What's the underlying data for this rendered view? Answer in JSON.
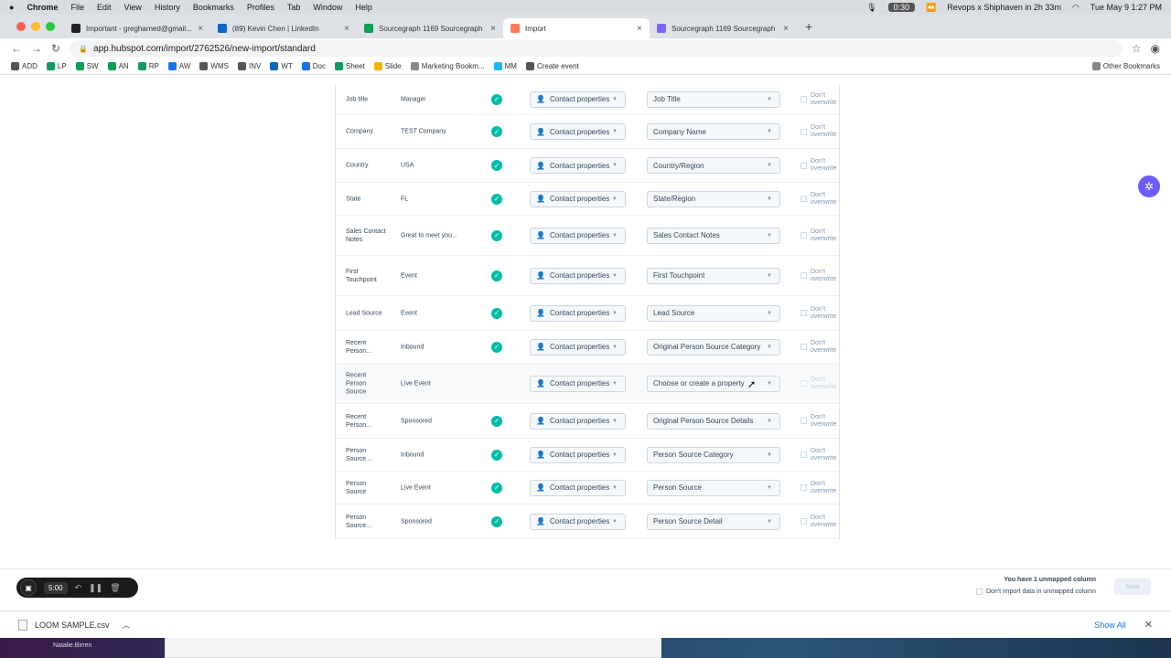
{
  "menubar": {
    "app": "Chrome",
    "items": [
      "File",
      "Edit",
      "View",
      "History",
      "Bookmarks",
      "Profiles",
      "Tab",
      "Window",
      "Help"
    ],
    "recording_time": "0:30",
    "calendar": "Revops x Shiphaven in 2h 33m",
    "clock": "Tue May 9  1:27 PM"
  },
  "tabs": [
    {
      "title": "Important - gregharned@gmail...",
      "color": "#222222",
      "badge": "14"
    },
    {
      "title": "(89) Kevin Chen | LinkedIn",
      "color": "#0a66c2"
    },
    {
      "title": "Sourcegraph 1169 Sourcegraph",
      "color": "#0f9d58"
    },
    {
      "title": "Import",
      "color": "#ff7a59",
      "active": true
    },
    {
      "title": "Sourcegraph 1169 Sourcegraph",
      "color": "#7b61ff"
    }
  ],
  "address": {
    "url": "app.hubspot.com/import/2762526/new-import/standard"
  },
  "bookmarks": [
    {
      "label": "ADD",
      "color": "#555"
    },
    {
      "label": "LP",
      "color": "#0f9d58"
    },
    {
      "label": "SW",
      "color": "#0f9d58"
    },
    {
      "label": "AN",
      "color": "#0f9d58"
    },
    {
      "label": "RP",
      "color": "#0f9d58"
    },
    {
      "label": "AW",
      "color": "#1a73e8"
    },
    {
      "label": "WMS",
      "color": "#555"
    },
    {
      "label": "INV",
      "color": "#555"
    },
    {
      "label": "WT",
      "color": "#0a66c2"
    },
    {
      "label": "Doc",
      "color": "#1a73e8"
    },
    {
      "label": "Sheet",
      "color": "#0f9d58"
    },
    {
      "label": "Slide",
      "color": "#f4b400"
    },
    {
      "label": "Marketing Bookm...",
      "color": "#888"
    },
    {
      "label": "MM",
      "color": "#1ab7ea"
    },
    {
      "label": "Create event",
      "color": "#555"
    }
  ],
  "other_bookmarks": "Other Bookmarks",
  "mapping": {
    "rows": [
      {
        "column": "Job title",
        "preview": "Manager",
        "mapped": true,
        "object": "Contact properties",
        "property": "Job Title",
        "overwrite": "Don't overwrite"
      },
      {
        "column": "Company",
        "preview": "TEST Company",
        "mapped": true,
        "object": "Contact properties",
        "property": "Company Name",
        "overwrite": "Don't overwrite"
      },
      {
        "column": "Country",
        "preview": "USA",
        "mapped": true,
        "object": "Contact properties",
        "property": "Country/Region",
        "overwrite": "Don't overwrite"
      },
      {
        "column": "State",
        "preview": "FL",
        "mapped": true,
        "object": "Contact properties",
        "property": "State/Region",
        "overwrite": "Don't overwrite"
      },
      {
        "column": "Sales Contact Notes",
        "preview": "Great to meet you...",
        "mapped": true,
        "object": "Contact properties",
        "property": "Sales Contact Notes",
        "overwrite": "Don't overwrite"
      },
      {
        "column": "First Touchpoint",
        "preview": "Event",
        "mapped": true,
        "object": "Contact properties",
        "property": "First Touchpoint",
        "overwrite": "Don't overwrite"
      },
      {
        "column": "Lead Source",
        "preview": "Event",
        "mapped": true,
        "object": "Contact properties",
        "property": "Lead Source",
        "overwrite": "Don't overwrite"
      },
      {
        "column": "Recent Person...",
        "preview": "Inbound",
        "mapped": true,
        "object": "Contact properties",
        "property": "Original Person Source Category",
        "overwrite": "Don't overwrite"
      },
      {
        "column": "Recent Person Source",
        "preview": "Live Event",
        "mapped": false,
        "object": "Contact properties",
        "property": "Choose or create a property",
        "overwrite": "Don't overwrite"
      },
      {
        "column": "Recent Person...",
        "preview": "Sponsored",
        "mapped": true,
        "object": "Contact properties",
        "property": "Original Person Source Details",
        "overwrite": "Don't overwrite"
      },
      {
        "column": "Person Source...",
        "preview": "Inbound",
        "mapped": true,
        "object": "Contact properties",
        "property": "Person Source Category",
        "overwrite": "Don't overwrite"
      },
      {
        "column": "Person Source",
        "preview": "Live Event",
        "mapped": true,
        "object": "Contact properties",
        "property": "Person Source",
        "overwrite": "Don't overwrite"
      },
      {
        "column": "Person Source...",
        "preview": "Sponsored",
        "mapped": true,
        "object": "Contact properties",
        "property": "Person Source Detail",
        "overwrite": "Don't overwrite"
      }
    ]
  },
  "footer": {
    "unmapped_text": "You have 1 unmapped column",
    "dont_import_label": "Don't import data in unmapped column",
    "next_label": "Next"
  },
  "loom": {
    "time": "5:00"
  },
  "downloads": {
    "file": "LOOM SAMPLE.csv",
    "show_all": "Show All"
  },
  "desktop": {
    "name": "Natalie.Birren"
  }
}
